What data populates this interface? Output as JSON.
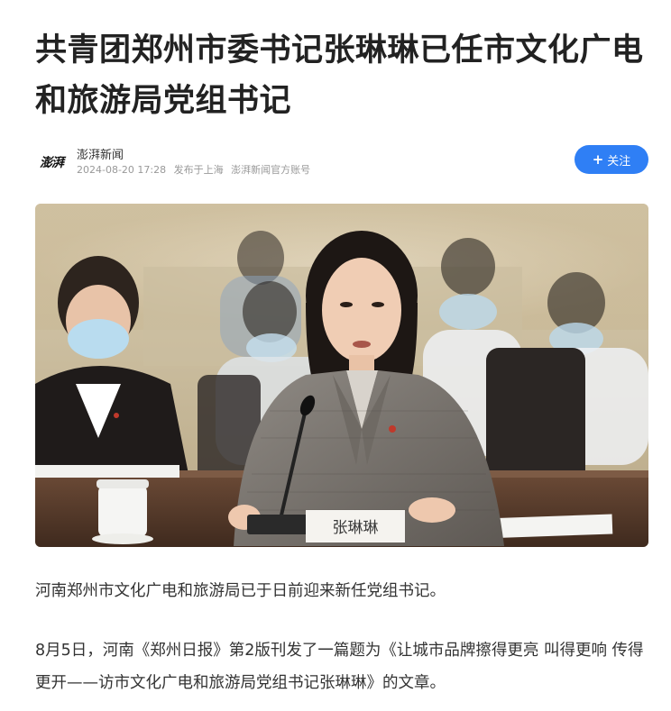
{
  "article": {
    "title": "共青团郑州市委书记张琳琳已任市文化广电和旅游局党组书记"
  },
  "author": {
    "avatar_text": "澎湃",
    "name": "澎湃新闻",
    "date": "2024-08-20 17:28",
    "location": "发布于上海",
    "source": "澎湃新闻官方账号",
    "follow_label": "关注",
    "follow_icon": "plus-icon"
  },
  "image": {
    "nameplate": "张琳琳"
  },
  "paragraphs": [
    "河南郑州市文化广电和旅游局已于日前迎来新任党组书记。",
    "8月5日，河南《郑州日报》第2版刊发了一篇题为《让城市品牌擦得更亮 叫得更响 传得更开——访市文化广电和旅游局党组书记张琳琳》的文章。"
  ],
  "colors": {
    "accent": "#2f7ff5",
    "title": "#222222",
    "meta": "#999999"
  }
}
